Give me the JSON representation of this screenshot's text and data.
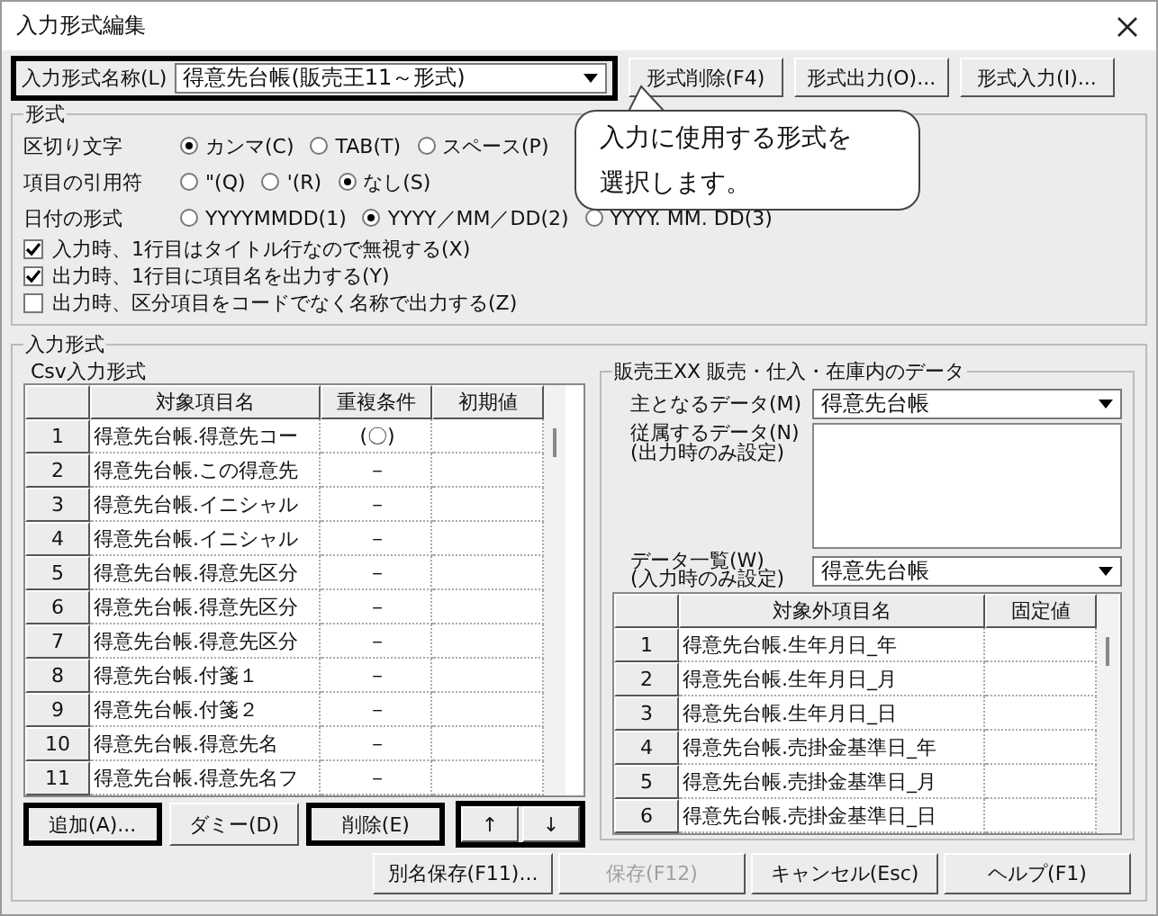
{
  "window": {
    "title": "入力形式編集"
  },
  "format_name": {
    "label": "入力形式名称(L)",
    "value": "得意先台帳(販売王11～形式)",
    "highlighted": true
  },
  "toolbar_buttons": [
    {
      "label": "形式削除(F4)"
    },
    {
      "label": "形式出力(O)..."
    },
    {
      "label": "形式入力(I)..."
    }
  ],
  "callout": {
    "text": "入力に使用する形式を選択します。"
  },
  "format": {
    "title": "形式",
    "rows": [
      {
        "label": "区切り文字",
        "options": [
          {
            "label": "カンマ(C)",
            "selected": true
          },
          {
            "label": "TAB(T)",
            "selected": false
          },
          {
            "label": "スペース(P)",
            "selected": false
          }
        ]
      },
      {
        "label": "項目の引用符",
        "options": [
          {
            "label": "\"(Q)",
            "selected": false
          },
          {
            "label": "'(R)",
            "selected": false
          },
          {
            "label": "なし(S)",
            "selected": true
          }
        ]
      },
      {
        "label": "日付の形式",
        "options": [
          {
            "label": "YYYYMMDD(1)",
            "selected": false
          },
          {
            "label": "YYYY／MM／DD(2)",
            "selected": true
          },
          {
            "label": "YYYY. MM. DD(3)",
            "selected": false
          }
        ]
      }
    ],
    "checks": [
      {
        "label": "入力時、1行目はタイトル行なので無視する(X)",
        "checked": true
      },
      {
        "label": "出力時、1行目に項目名を出力する(Y)",
        "checked": true
      },
      {
        "label": "出力時、区分項目をコードでなく名称で出力する(Z)",
        "checked": false
      }
    ]
  },
  "input_format": {
    "title": "入力形式",
    "subtitle": "Csv入力形式",
    "columns": [
      "対象項目名",
      "重複条件",
      "初期値"
    ],
    "rows": [
      {
        "number": "1",
        "name": "得意先台帳.得意先コー",
        "duplicate": "(〇)"
      },
      {
        "number": "2",
        "name": "得意先台帳.この得意先",
        "duplicate": "－"
      },
      {
        "number": "3",
        "name": "得意先台帳.イニシャル",
        "duplicate": "－"
      },
      {
        "number": "4",
        "name": "得意先台帳.イニシャル",
        "duplicate": "－"
      },
      {
        "number": "5",
        "name": "得意先台帳.得意先区分",
        "duplicate": "－"
      },
      {
        "number": "6",
        "name": "得意先台帳.得意先区分",
        "duplicate": "－"
      },
      {
        "number": "7",
        "name": "得意先台帳.得意先区分",
        "duplicate": "－"
      },
      {
        "number": "8",
        "name": "得意先台帳.付箋１",
        "duplicate": "－"
      },
      {
        "number": "9",
        "name": "得意先台帳.付箋２",
        "duplicate": "－"
      },
      {
        "number": "10",
        "name": "得意先台帳.得意先名",
        "duplicate": "－"
      },
      {
        "number": "11",
        "name": "得意先台帳.得意先名フ",
        "duplicate": "－"
      }
    ],
    "buttons": [
      {
        "label": "追加(A)...",
        "highlighted": true
      },
      {
        "label": "ダミー(D)",
        "highlighted": false
      },
      {
        "label": "削除(E)",
        "highlighted": true
      }
    ],
    "move_buttons": {
      "highlighted": true,
      "labels": [
        "↑",
        "↓"
      ]
    }
  },
  "data_group": {
    "title": "販売王XX 販売・仕入・在庫内のデータ",
    "main_data": {
      "label": "主となるデータ(M)",
      "value": "得意先台帳"
    },
    "dependent_data": {
      "label": "従属するデータ(N)",
      "note": "(出力時のみ設定)"
    },
    "data_list": {
      "label": "データ一覧(W)",
      "note": "(入力時のみ設定)",
      "value": "得意先台帳"
    },
    "columns": [
      "対象外項目名",
      "固定値"
    ],
    "rows": [
      {
        "number": "1",
        "name": "得意先台帳.生年月日_年"
      },
      {
        "number": "2",
        "name": "得意先台帳.生年月日_月"
      },
      {
        "number": "3",
        "name": "得意先台帳.生年月日_日"
      },
      {
        "number": "4",
        "name": "得意先台帳.売掛金基準日_年"
      },
      {
        "number": "5",
        "name": "得意先台帳.売掛金基準日_月"
      },
      {
        "number": "6",
        "name": "得意先台帳.売掛金基準日_日"
      }
    ]
  },
  "bottom_buttons": [
    {
      "label": "別名保存(F11)...",
      "disabled": false
    },
    {
      "label": "保存(F12)",
      "disabled": true
    },
    {
      "label": "キャンセル(Esc)",
      "disabled": false
    },
    {
      "label": "ヘルプ(F1)",
      "disabled": false
    }
  ]
}
